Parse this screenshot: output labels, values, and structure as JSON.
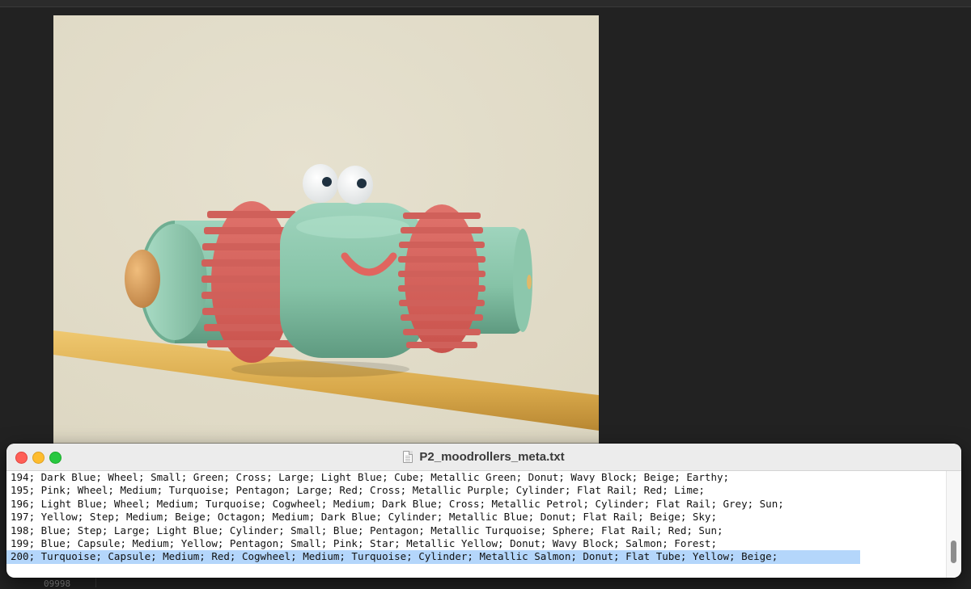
{
  "colors": {
    "background": "#222222",
    "selection": "#b4d6fb",
    "close": "#ff5f57",
    "minimize": "#febc2e",
    "maximize": "#28c840"
  },
  "viewer": {
    "icon": "moodroller-render-image"
  },
  "background_label": "09998",
  "text_window": {
    "title": "P2_moodrollers_meta.txt",
    "title_icon": "text-document-icon",
    "lines": [
      "194; Dark Blue; Wheel; Small; Green; Cross; Large; Light Blue; Cube; Metallic Green; Donut; Wavy Block; Beige; Earthy;",
      "195; Pink; Wheel; Medium; Turquoise; Pentagon; Large; Red; Cross; Metallic Purple; Cylinder; Flat Rail; Red; Lime;",
      "196; Light Blue; Wheel; Medium; Turquoise; Cogwheel; Medium; Dark Blue; Cross; Metallic Petrol; Cylinder; Flat Rail; Grey; Sun;",
      "197; Yellow; Step; Medium; Beige; Octagon; Medium; Dark Blue; Cylinder; Metallic Blue; Donut; Flat Rail; Beige; Sky;",
      "198; Blue; Step; Large; Light Blue; Cylinder; Small; Blue; Pentagon; Metallic Turquoise; Sphere; Flat Rail; Red; Sun;",
      "199; Blue; Capsule; Medium; Yellow; Pentagon; Small; Pink; Star; Metallic Yellow; Donut; Wavy Block; Salmon; Forest;",
      "200; Turquoise; Capsule; Medium; Red; Cogwheel; Medium; Turquoise; Cylinder; Metallic Salmon; Donut; Flat Tube; Yellow; Beige;"
    ],
    "selected_line_index": 6
  }
}
